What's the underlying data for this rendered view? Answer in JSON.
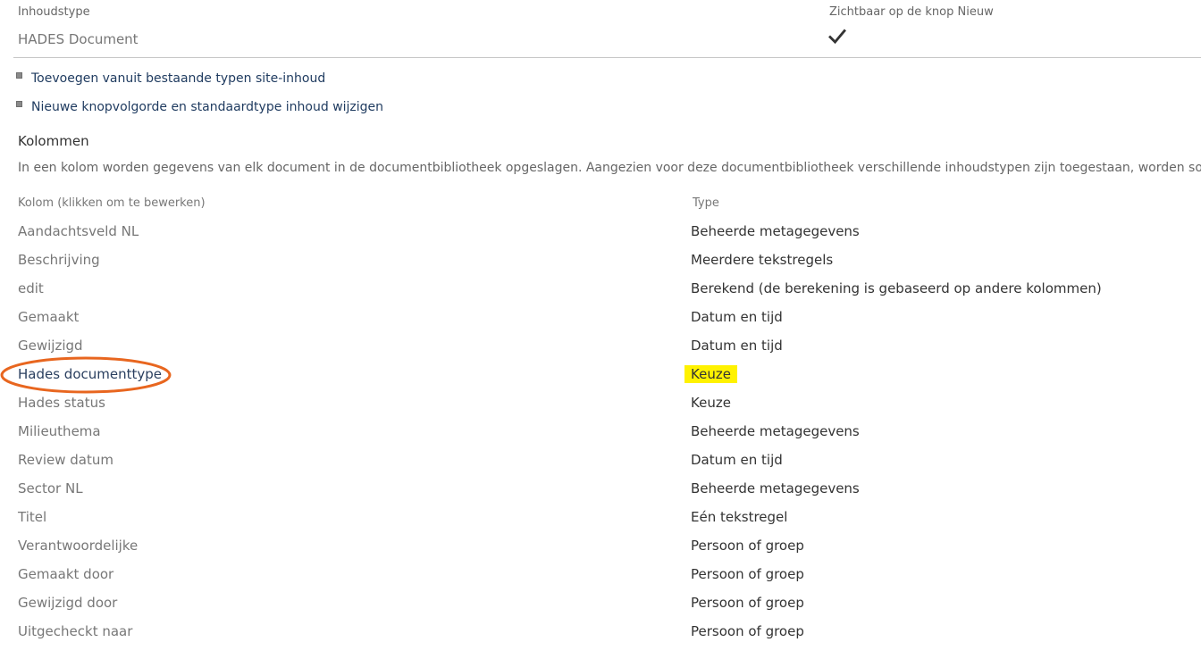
{
  "header": {
    "content_type_label": "Inhoudstype",
    "visible_label": "Zichtbaar op de knop Nieuw",
    "content_type_name": "HADES Document",
    "visible_icon": "checkmark-icon"
  },
  "links": [
    {
      "label": "Toevoegen vanuit bestaande typen site-inhoud",
      "icon": "bullet-square-icon"
    },
    {
      "label": "Nieuwe knopvolgorde en standaardtype inhoud wijzigen",
      "icon": "bullet-square-icon"
    }
  ],
  "columns_section": {
    "title": "Kolommen",
    "description": "In een kolom worden gegevens van elk document in de documentbibliotheek opgeslagen. Aangezien voor deze documentbibliotheek verschillende inhoudstypen zijn toegestaan, worden sommige kolomins",
    "header_name": "Kolom (klikken om te bewerken)",
    "header_type": "Type"
  },
  "rows": [
    {
      "name": "Aandachtsveld NL",
      "type": "Beheerde metagegevens"
    },
    {
      "name": "Beschrijving",
      "type": "Meerdere tekstregels"
    },
    {
      "name": "edit",
      "type": "Berekend (de berekening is gebaseerd op andere kolommen)"
    },
    {
      "name": "Gemaakt",
      "type": "Datum en tijd"
    },
    {
      "name": "Gewijzigd",
      "type": "Datum en tijd"
    },
    {
      "name": "Hades documenttype",
      "type": "Keuze",
      "highlighted": true
    },
    {
      "name": "Hades status",
      "type": "Keuze"
    },
    {
      "name": "Milieuthema",
      "type": "Beheerde metagegevens"
    },
    {
      "name": "Review datum",
      "type": "Datum en tijd"
    },
    {
      "name": "Sector NL",
      "type": "Beheerde metagegevens"
    },
    {
      "name": "Titel",
      "type": "Eén tekstregel"
    },
    {
      "name": "Verantwoordelijke",
      "type": "Persoon of groep"
    },
    {
      "name": "Gemaakt door",
      "type": "Persoon of groep"
    },
    {
      "name": "Gewijzigd door",
      "type": "Persoon of groep"
    },
    {
      "name": "Uitgecheckt naar",
      "type": "Persoon of groep"
    }
  ],
  "colors": {
    "highlight": "#fff200",
    "annotation_circle": "#e8661f",
    "link": "#1e3a5f"
  }
}
